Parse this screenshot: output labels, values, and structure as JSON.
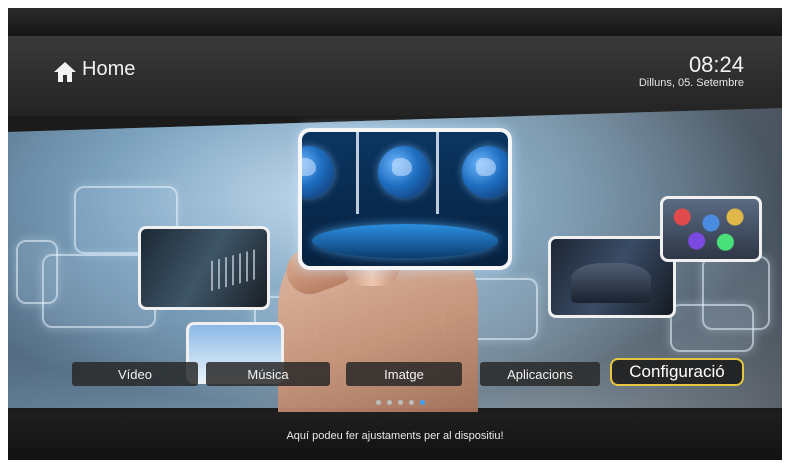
{
  "header": {
    "home_label": "Home",
    "time": "08:24",
    "date": "Dilluns, 05. Setembre"
  },
  "menu": {
    "items": [
      {
        "label": "Vídeo"
      },
      {
        "label": "Música"
      },
      {
        "label": "Imatge"
      },
      {
        "label": "Aplicacions"
      },
      {
        "label": "Configuració",
        "selected": true
      }
    ]
  },
  "pager": {
    "count": 5,
    "active_index": 4
  },
  "hint": "Aquí podeu fer ajustaments per al dispositiu!",
  "colors": {
    "selection_border": "#e6c640",
    "pager_active": "#3aa6ff"
  }
}
